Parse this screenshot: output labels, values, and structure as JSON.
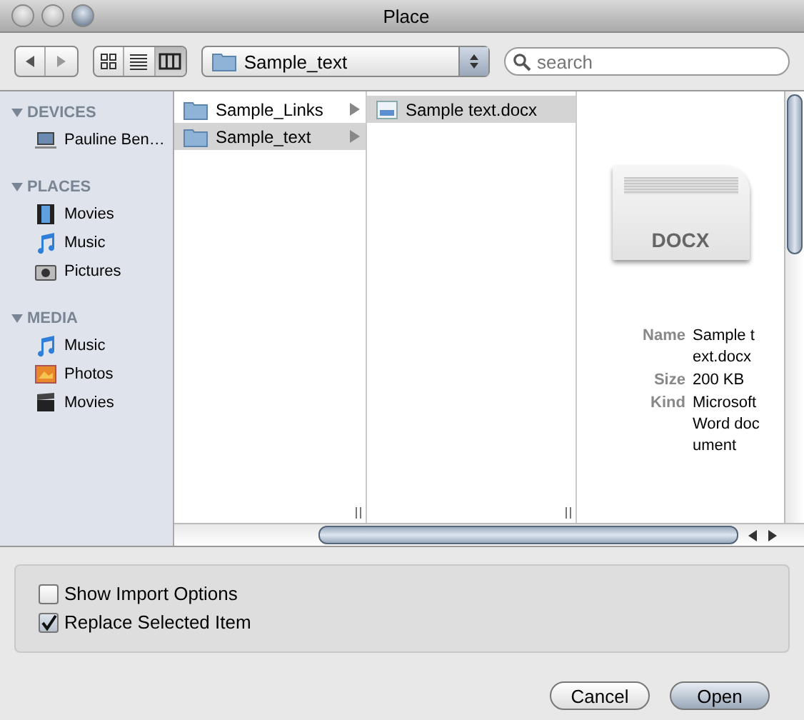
{
  "window": {
    "title": "Place"
  },
  "toolbar": {
    "view_modes": [
      {
        "selected": false
      },
      {
        "selected": false
      },
      {
        "selected": true
      }
    ],
    "location": "Sample_text",
    "search": {
      "placeholder": "search"
    }
  },
  "sidebar": {
    "sections": [
      {
        "title": "DEVICES",
        "expanded": true,
        "items": [
          {
            "label": "Pauline Ben…"
          }
        ]
      },
      {
        "title": "PLACES",
        "expanded": true,
        "items": [
          {
            "label": "Movies"
          },
          {
            "label": "Music"
          },
          {
            "label": "Pictures"
          }
        ]
      },
      {
        "title": "MEDIA",
        "expanded": true,
        "items": [
          {
            "label": "Music"
          },
          {
            "label": "Photos"
          },
          {
            "label": "Movies"
          }
        ]
      }
    ]
  },
  "columns": [
    {
      "items": [
        {
          "kind": "folder",
          "label": "Sample_Links",
          "selected": false
        },
        {
          "kind": "folder",
          "label": "Sample_text",
          "selected": true
        }
      ]
    },
    {
      "items": [
        {
          "kind": "file",
          "label": "Sample text.docx",
          "selected": true
        }
      ]
    }
  ],
  "preview": {
    "badge": "DOCX",
    "info": [
      {
        "key": "Name",
        "value": "Sample text.docx"
      },
      {
        "key": "Size",
        "value": "200 KB"
      },
      {
        "key": "Kind",
        "value": "Microsoft Word document"
      }
    ]
  },
  "options": [
    {
      "label": "Show Import Options",
      "checked": false
    },
    {
      "label": "Replace Selected Item",
      "checked": true
    }
  ],
  "buttons": [
    {
      "label": "Cancel",
      "default": false
    },
    {
      "label": "Open",
      "default": true
    }
  ]
}
